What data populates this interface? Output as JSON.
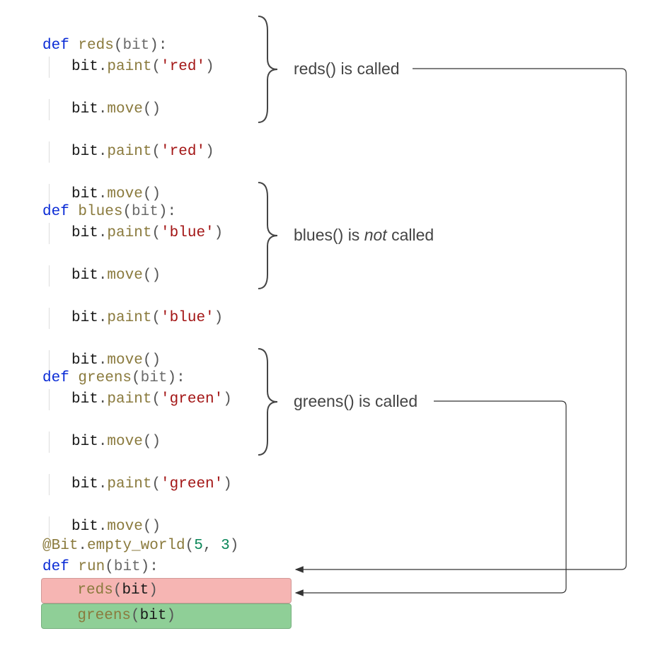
{
  "colors": {
    "keyword": "#0a2bd6",
    "function": "#8a7a3d",
    "string": "#a31515",
    "number": "#098658",
    "highlight_red": "#f6b5b3",
    "highlight_green": "#8fcf97"
  },
  "functions": [
    {
      "name": "reds",
      "param": "bit",
      "body": [
        {
          "method": "paint",
          "arg": "'red'"
        },
        {
          "method": "move",
          "arg": ""
        },
        {
          "method": "paint",
          "arg": "'red'"
        },
        {
          "method": "move",
          "arg": ""
        }
      ]
    },
    {
      "name": "blues",
      "param": "bit",
      "body": [
        {
          "method": "paint",
          "arg": "'blue'"
        },
        {
          "method": "move",
          "arg": ""
        },
        {
          "method": "paint",
          "arg": "'blue'"
        },
        {
          "method": "move",
          "arg": ""
        }
      ]
    },
    {
      "name": "greens",
      "param": "bit",
      "body": [
        {
          "method": "paint",
          "arg": "'green'"
        },
        {
          "method": "move",
          "arg": ""
        },
        {
          "method": "paint",
          "arg": "'green'"
        },
        {
          "method": "move",
          "arg": ""
        }
      ]
    }
  ],
  "decorator": {
    "prefix": "@",
    "cls": "Bit",
    "method": "empty_world",
    "args": [
      "5",
      "3"
    ]
  },
  "run_fn": {
    "name": "run",
    "param": "bit",
    "calls": [
      {
        "fn": "reds",
        "arg": "bit",
        "highlight": "red"
      },
      {
        "fn": "greens",
        "arg": "bit",
        "highlight": "green"
      }
    ]
  },
  "annotations": {
    "reds_label_a": "reds() is ",
    "reds_label_b": "called",
    "blues_label_a": "blues() is ",
    "blues_label_b": "not",
    "blues_label_c": " called",
    "greens_label_a": "greens() is ",
    "greens_label_b": "called"
  },
  "kw_def": "def"
}
